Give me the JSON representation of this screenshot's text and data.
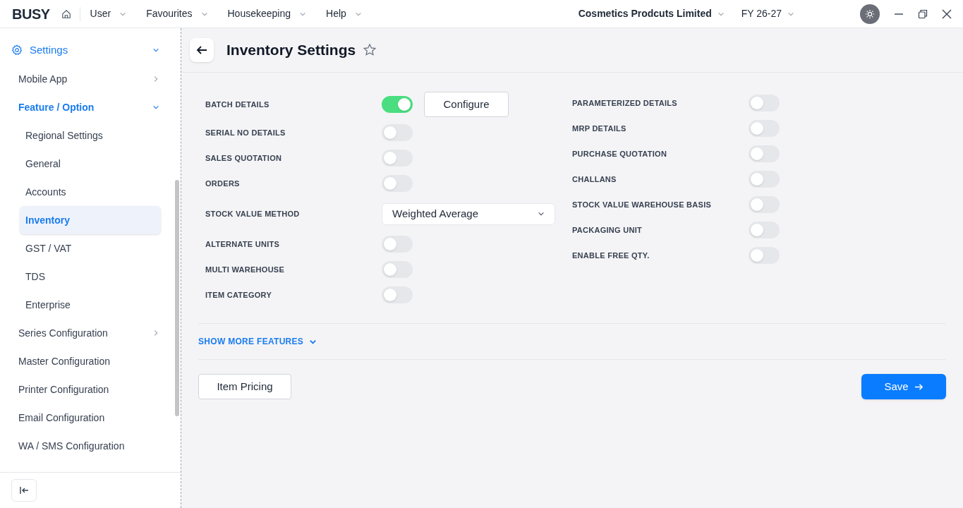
{
  "app": {
    "logo": "BUSY"
  },
  "menu": [
    {
      "label": "User"
    },
    {
      "label": "Favourites"
    },
    {
      "label": "Housekeeping"
    },
    {
      "label": "Help"
    }
  ],
  "company": {
    "label": "Cosmetics Prodcuts Limited"
  },
  "fiscal_year": {
    "label": "FY 26-27"
  },
  "sidebar": {
    "items": [
      {
        "label": "Settings",
        "expanded": true,
        "children": [
          {
            "label": "Mobile App",
            "expanded": false,
            "selected": false
          },
          {
            "label": "Feature / Option",
            "expanded": true,
            "selected": false,
            "children": [
              {
                "label": "Regional Settings",
                "selected": false
              },
              {
                "label": "General",
                "selected": false
              },
              {
                "label": "Accounts",
                "selected": false
              },
              {
                "label": "Inventory",
                "selected": true
              },
              {
                "label": "GST / VAT",
                "selected": false
              },
              {
                "label": "TDS",
                "selected": false
              },
              {
                "label": "Enterprise",
                "selected": false
              }
            ]
          },
          {
            "label": "Series Configuration",
            "expanded": false,
            "selected": false
          },
          {
            "label": "Master Configuration",
            "selected": false
          },
          {
            "label": "Printer Configuration",
            "selected": false
          },
          {
            "label": "Email Configuration",
            "selected": false
          },
          {
            "label": "WA / SMS Configuration",
            "selected": false
          }
        ]
      }
    ]
  },
  "page": {
    "title": "Inventory Settings"
  },
  "left_settings": [
    {
      "kind": "toggle",
      "label": "BATCH DETAILS",
      "on": true,
      "action": "Configure"
    },
    {
      "kind": "toggle",
      "label": "SERIAL NO DETAILS",
      "on": false
    },
    {
      "kind": "toggle",
      "label": "SALES QUOTATION",
      "on": false
    },
    {
      "kind": "toggle",
      "label": "ORDERS",
      "on": false
    },
    {
      "kind": "select",
      "label": "STOCK VALUE METHOD",
      "value": "Weighted Average"
    },
    {
      "kind": "toggle",
      "label": "ALTERNATE UNITS",
      "on": false
    },
    {
      "kind": "toggle",
      "label": "MULTI WAREHOUSE",
      "on": false
    },
    {
      "kind": "toggle",
      "label": "ITEM CATEGORY",
      "on": false
    }
  ],
  "right_settings": [
    {
      "kind": "toggle",
      "label": "PARAMETERIZED DETAILS",
      "on": false
    },
    {
      "kind": "toggle",
      "label": "MRP DETAILS",
      "on": false
    },
    {
      "kind": "toggle",
      "label": "PURCHASE QUOTATION",
      "on": false
    },
    {
      "kind": "toggle",
      "label": "CHALLANS",
      "on": false
    },
    {
      "kind": "toggle",
      "label": "STOCK VALUE WAREHOUSE BASIS",
      "on": false
    },
    {
      "kind": "toggle",
      "label": "PACKAGING UNIT",
      "on": false
    },
    {
      "kind": "toggle",
      "label": "ENABLE FREE QTY.",
      "on": false
    }
  ],
  "show_more": {
    "label": "SHOW MORE FEATURES"
  },
  "buttons": [
    {
      "label": "Item Pricing",
      "kind": "secondary"
    },
    {
      "label": "Save",
      "kind": "primary"
    }
  ]
}
